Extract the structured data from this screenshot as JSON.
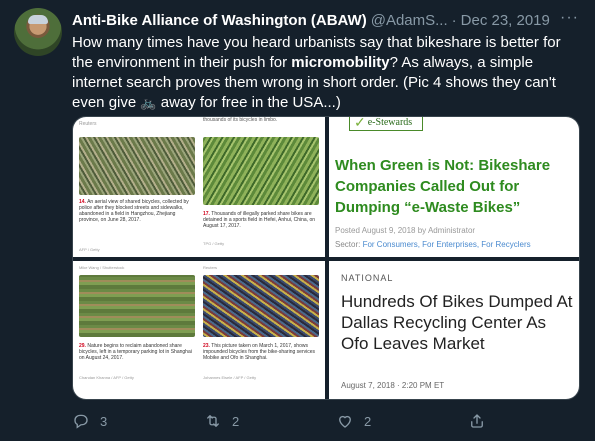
{
  "tweet": {
    "author_name": "Anti-Bike Alliance of Washington (ABAW)",
    "handle": "@AdamS...",
    "separator": "·",
    "date": "Dec 23, 2019",
    "more_icon": "more-icon",
    "text_part1": "How many times have you heard urbanists say that bikeshare is better for the environment in their push for ",
    "text_bold": "micromobility",
    "text_part2": "? As always, a simple internet search proves them wrong in short order. (Pic 4 shows they can't even give ",
    "emoji": "🚲",
    "text_part3": " away for free in the USA...)"
  },
  "media": {
    "pic1": {
      "top_label": "Reuters",
      "caption_num": "14.",
      "caption": "An aerial view of shared bicycles, collected by police after they blocked streets and sidewalks, abandoned in a field in Hangzhou, Zhejiang province, on June 28, 2017.",
      "credit": "AFP / Getty",
      "caption2_num": "17.",
      "caption2": "Thousands of illegally parked share bikes are detained in a sports field in Hefei, Anhui, China, on August 17, 2017.",
      "credit2": "TPG / Getty",
      "top_text": "thousands of its bicycles in limbo."
    },
    "pic2": {
      "logo_text": "e-Stewards",
      "headline": "When Green is Not: Bikeshare Companies Called Out for Dumping “e-Waste Bikes”",
      "posted": "Posted August 9, 2018 by Administrator",
      "sector_label": "Sector: ",
      "sector_links": "For Consumers, For Enterprises, For Recyclers"
    },
    "pic3": {
      "top_credit": "Mike Wang / Shutterstock",
      "caption_num": "29.",
      "caption": "Nature begins to reclaim abandoned share bicycles, left in a temporary parking lot in Shanghai on August 24, 2017.",
      "credit": "Chandan Khanna / AFP / Getty",
      "caption2_num": "23.",
      "caption2": "This picture taken on March 1, 2017, shows impounded bicycles from the bike-sharing services Mobike and Ofo in Shanghai.",
      "credit2": "Johannes Eisele / AFP / Getty",
      "top_credit2": "Reuters"
    },
    "pic4": {
      "kicker": "NATIONAL",
      "headline": "Hundreds Of Bikes Dumped At Dallas Recycling Center As Ofo Leaves Market",
      "stamp": "August 7, 2018 · 2:20 PM ET"
    }
  },
  "actions": {
    "reply_count": "3",
    "retweet_count": "2",
    "like_count": "2",
    "icons": [
      "reply-icon",
      "retweet-icon",
      "like-icon",
      "share-icon"
    ]
  },
  "colors": {
    "background": "#15202b",
    "secondary_text": "#8899a6",
    "estewards_green": "#2e8b1f",
    "link_blue": "#4a8acf"
  }
}
